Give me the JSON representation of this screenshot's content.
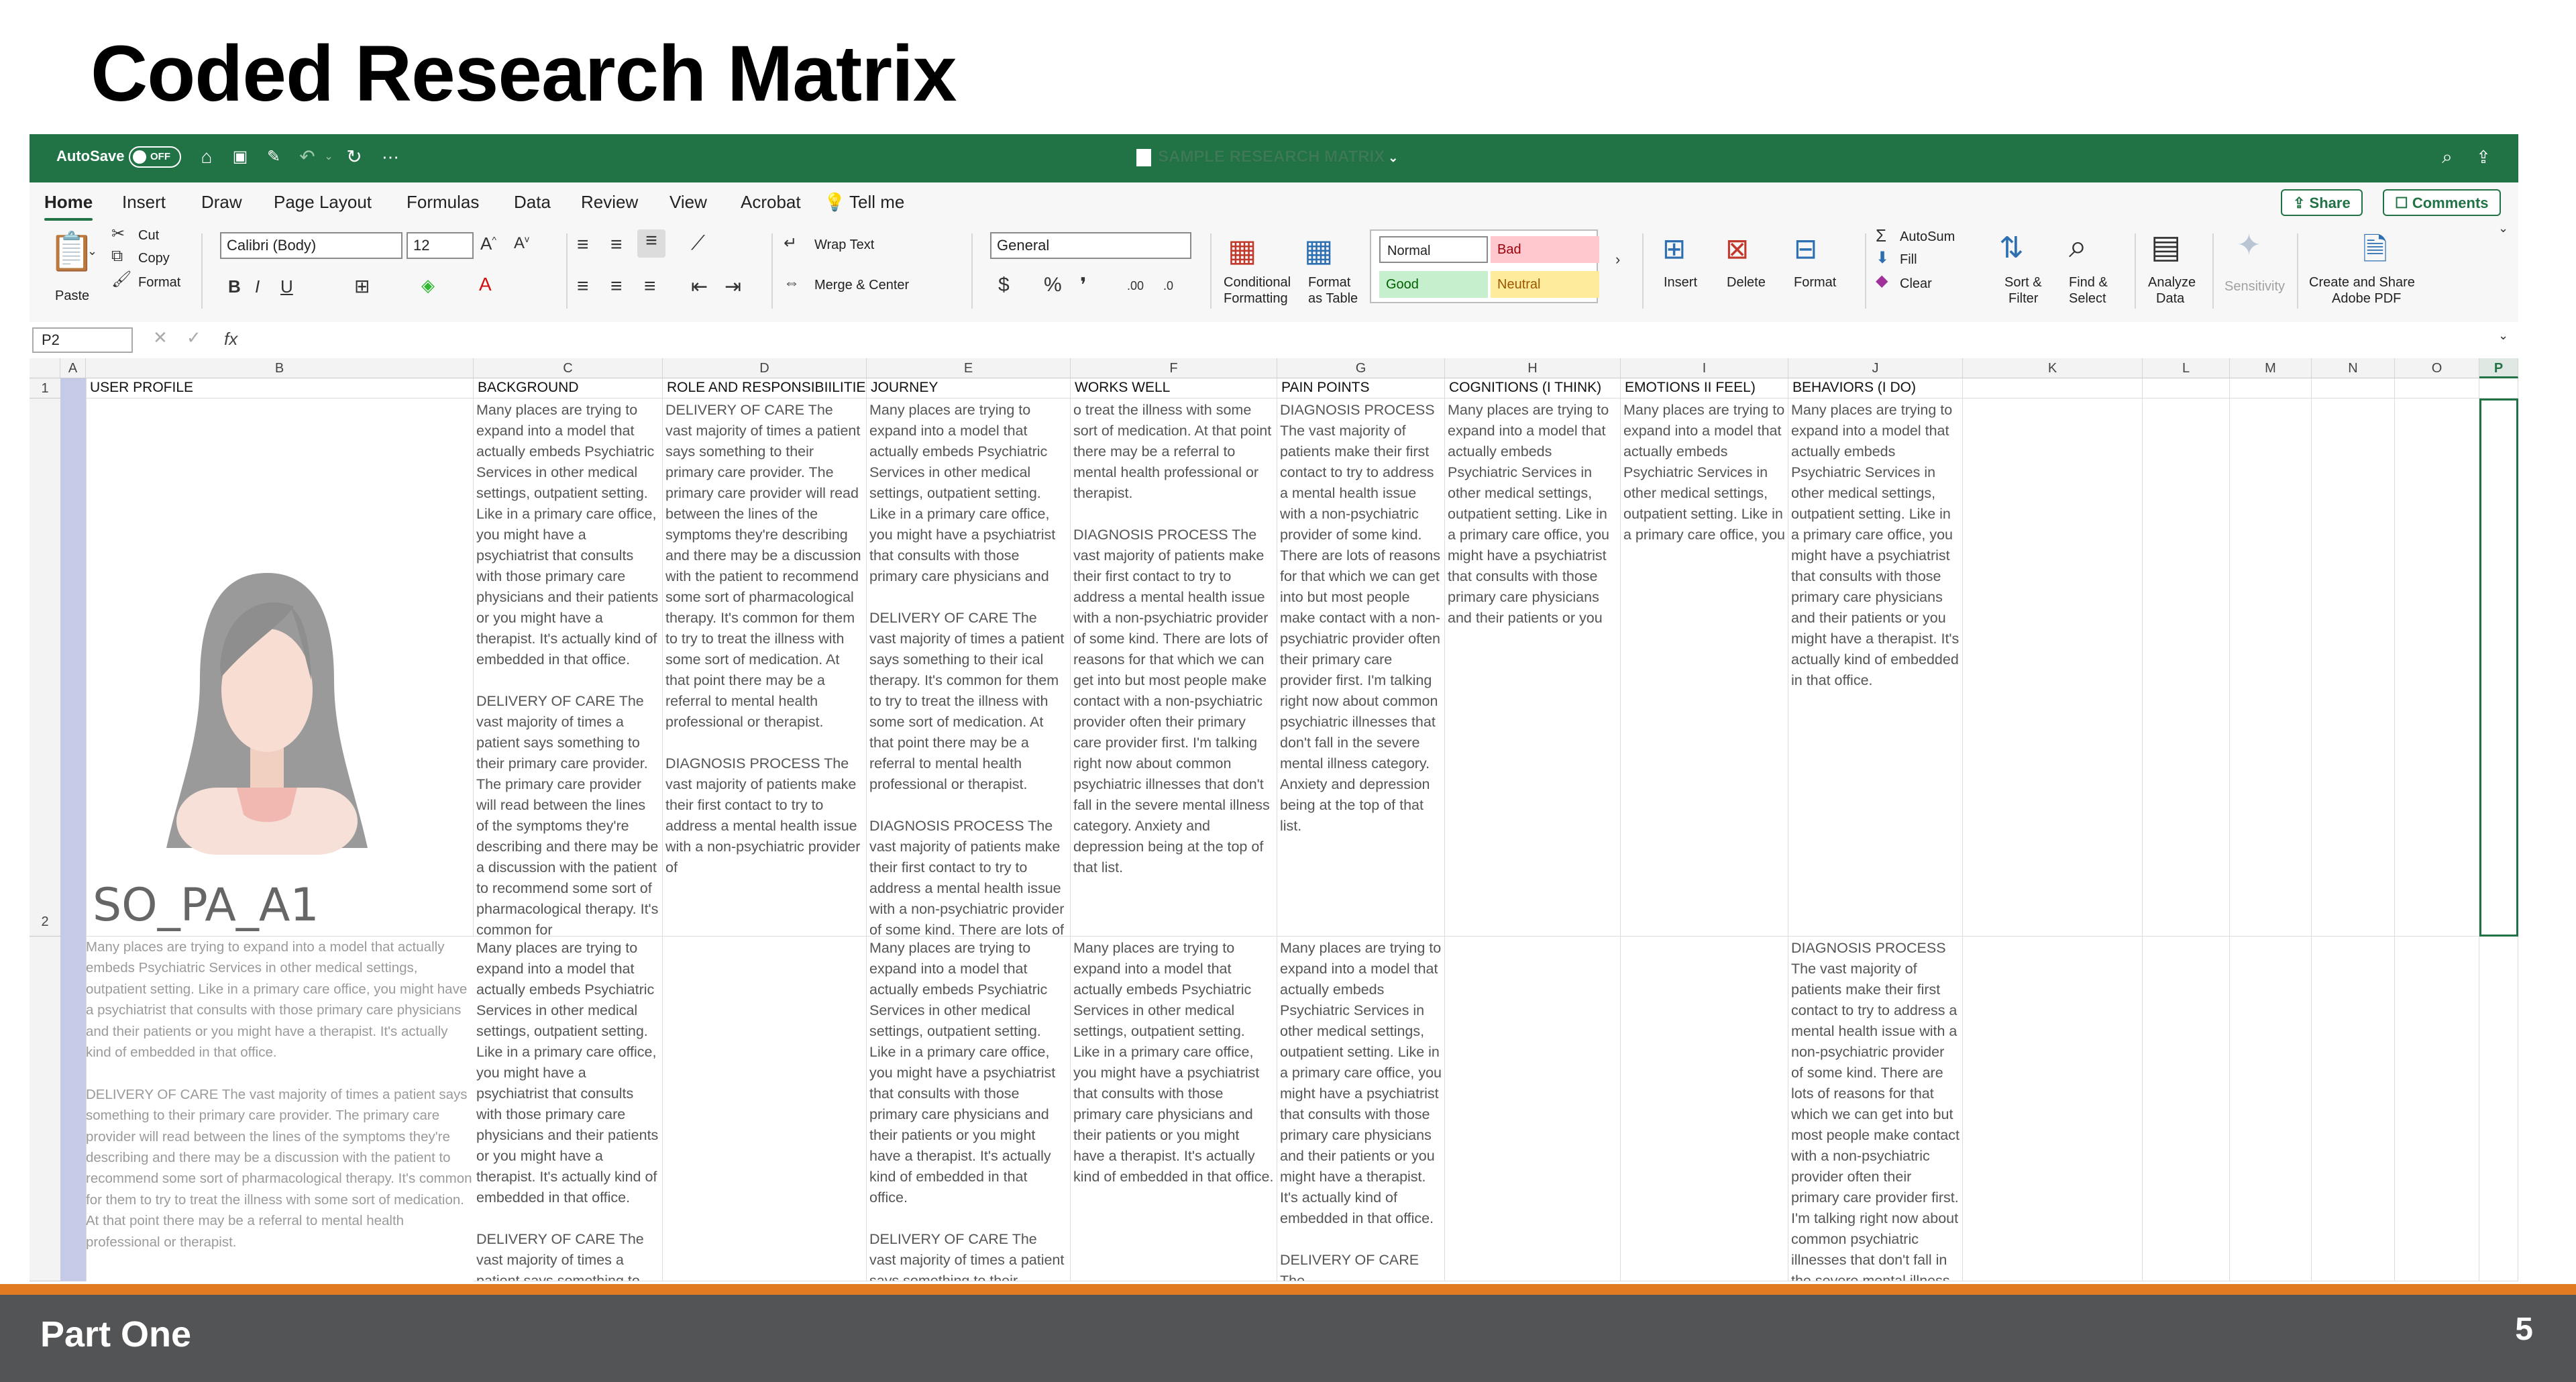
{
  "slide": {
    "title": "Coded Research Matrix",
    "footer_label": "Part One",
    "page_number": "5"
  },
  "titlebar": {
    "autosave_label": "AutoSave",
    "autosave_state": "OFF",
    "document_title": "SAMPLE RESEARCH MATRIX"
  },
  "ribbon_tabs": [
    "Home",
    "Insert",
    "Draw",
    "Page Layout",
    "Formulas",
    "Data",
    "Review",
    "View",
    "Acrobat",
    "Tell me"
  ],
  "ribbon_buttons": {
    "share": "Share",
    "comments": "Comments"
  },
  "ribbon": {
    "paste": "Paste",
    "cut": "Cut",
    "copy": "Copy",
    "format_painter": "Format",
    "font_name": "Calibri (Body)",
    "font_size": "12",
    "wrap_text": "Wrap Text",
    "merge_center": "Merge & Center",
    "number_format": "General",
    "conditional_formatting_1": "Conditional",
    "conditional_formatting_2": "Formatting",
    "format_table_1": "Format",
    "format_table_2": "as Table",
    "style_normal": "Normal",
    "style_bad": "Bad",
    "style_good": "Good",
    "style_neutral": "Neutral",
    "insert": "Insert",
    "delete": "Delete",
    "format": "Format",
    "autosum": "AutoSum",
    "fill": "Fill",
    "clear": "Clear",
    "sort_filter_1": "Sort &",
    "sort_filter_2": "Filter",
    "find_select_1": "Find &",
    "find_select_2": "Select",
    "analyze_1": "Analyze",
    "analyze_2": "Data",
    "sensitivity": "Sensitivity",
    "adobe_1": "Create and Share",
    "adobe_2": "Adobe PDF"
  },
  "formula_bar": {
    "name_box": "P2",
    "fx": "fx"
  },
  "colors": {
    "excel_green": "#217346",
    "footer_gray": "#525456",
    "footer_accent": "#e07b22"
  },
  "grid": {
    "columns": [
      "A",
      "B",
      "C",
      "D",
      "E",
      "F",
      "G",
      "H",
      "I",
      "J",
      "K",
      "L",
      "M",
      "N",
      "O",
      "P"
    ],
    "rows": [
      "1",
      "2"
    ],
    "headers": [
      "USER PROFILE",
      "BACKGROUND",
      "ROLE AND RESPONSIBIILITIES",
      "JOURNEY",
      "WORKS WELL",
      "PAIN POINTS",
      "COGNITIONS (I THINK)",
      "EMOTIONS II FEEL)",
      "BEHAVIORS (I DO)"
    ],
    "profile_label": "SO_PA_A1",
    "row2": {
      "background": "Many places are trying to expand into a model that actually embeds Psychiatric Services in other medical settings, outpatient setting. Like in a primary care office, you might have a psychiatrist that consults with those primary care physicians and their patients or you might have a therapist. It's actually kind of embedded in that office.\n\nDELIVERY OF CARE The vast majority of times a patient says something to their primary care provider. The primary care provider will read between the lines of the symptoms they're describing and there may be a discussion with the patient to recommend some sort of pharmacological therapy. It's common for",
      "role": "DELIVERY OF CARE The vast majority of times a patient says something to their primary care provider. The primary care provider will read between the lines of the symptoms they're describing and there may be a discussion with the patient to recommend some sort of pharmacological therapy. It's common for them to try to treat the illness with some sort of medication. At that point there may be a referral to mental health professional or therapist.\n\nDIAGNOSIS PROCESS The vast majority of patients make their first contact to try to address a mental health issue with a non-psychiatric provider of",
      "journey": "Many places are trying to expand into a model that actually embeds Psychiatric Services in other medical settings, outpatient setting. Like in a primary care office, you might have a psychiatrist that consults with those primary care physicians and\n\nDELIVERY OF CARE The vast majority of times a patient says something to their ical therapy. It's common for them to try to treat the illness with some sort of medication. At that point there may be a referral to mental health professional or therapist.\n\nDIAGNOSIS PROCESS The vast majority of patients make their first contact to try to address a mental health issue with a non-psychiatric provider of some kind. There are lots of",
      "works_well": "o treat the illness with some sort of medication. At that point there may be a referral to mental health professional or therapist.\n\nDIAGNOSIS PROCESS The vast majority of patients make their first contact to try to address a mental health issue with a non-psychiatric provider of some kind. There are lots of reasons for that which we can get into but most people make contact with a non-psychiatric provider often their primary care provider first. I'm talking right now about common psychiatric illnesses that don't fall in the severe mental illness category. Anxiety and depression being at the top of that list.",
      "pain_points": "DIAGNOSIS PROCESS The vast majority of patients make their first contact to try to address a mental health issue with a non-psychiatric provider of some kind. There are lots of reasons for that which we can get into but most people make contact with a non-psychiatric provider often their primary care provider first. I'm talking right now about common psychiatric illnesses that don't fall in the severe mental illness category. Anxiety and depression being at the top of that list.",
      "cognitions": "Many places are trying to expand into a model that actually embeds Psychiatric Services in other medical settings, outpatient setting. Like in a primary care office, you might have a psychiatrist that consults with those primary care physicians and their patients or you",
      "emotions": "Many places are trying to expand into a model that actually embeds Psychiatric Services in other medical settings, outpatient setting. Like in a primary care office, you",
      "behaviors": "Many places are trying to expand into a model that actually embeds Psychiatric Services in other medical settings, outpatient setting. Like in a primary care office, you might have a psychiatrist that consults with those primary care physicians and their patients or you might have a therapist. It's actually kind of embedded in that office."
    },
    "row3": {
      "profile": "Many places are trying to expand into a model that actually embeds Psychiatric Services in other medical settings, outpatient setting. Like in a primary care office, you might have a psychiatrist that consults with those primary care physicians and their patients or you might have a therapist. It's actually kind of embedded in that office.\n\nDELIVERY OF CARE The vast majority of times a patient says something to their primary care provider. The primary care provider will read between the lines of the symptoms they're describing and there may be a discussion with the patient to recommend some sort of pharmacological therapy. It's common for them to try to treat the illness with some sort of medication. At that point there may be a referral to mental health professional or therapist.",
      "background": "Many places are trying to expand into a model that actually embeds Psychiatric Services in other medical settings, outpatient setting. Like in a primary care office, you might have a psychiatrist that consults with those primary care physicians and their patients or you might have a therapist. It's actually kind of embedded in that office.\n\nDELIVERY OF CARE The vast majority of times a patient says something to their",
      "journey": "Many places are trying to expand into a model that actually embeds Psychiatric Services in other medical settings, outpatient setting. Like in a primary care office, you might have a psychiatrist that consults with those primary care physicians and their patients or you might have a therapist. It's actually kind of embedded in that office.\n\nDELIVERY OF CARE The vast majority of times a patient says something to their",
      "works_well": "Many places are trying to expand into a model that actually embeds Psychiatric Services in other medical settings, outpatient setting. Like in a primary care office, you might have a psychiatrist that consults with those primary care physicians and their patients or you might have a therapist. It's actually kind of embedded in that office.",
      "pain_points": "Many places are trying to expand into a model that actually embeds Psychiatric Services in other medical settings, outpatient setting. Like in a primary care office, you might have a psychiatrist that consults with those primary care physicians and their patients or you might have a therapist. It's actually kind of embedded in that office.\n\nDELIVERY OF CARE The",
      "behaviors": "DIAGNOSIS PROCESS The vast majority of patients make their first contact to try to address a mental health issue with a non-psychiatric provider of some kind. There are lots of reasons for that which we can get into but most people make contact with a non-psychiatric provider often their primary care provider first. I'm talking right now about common psychiatric illnesses that don't fall in the severe mental illness category."
    }
  }
}
